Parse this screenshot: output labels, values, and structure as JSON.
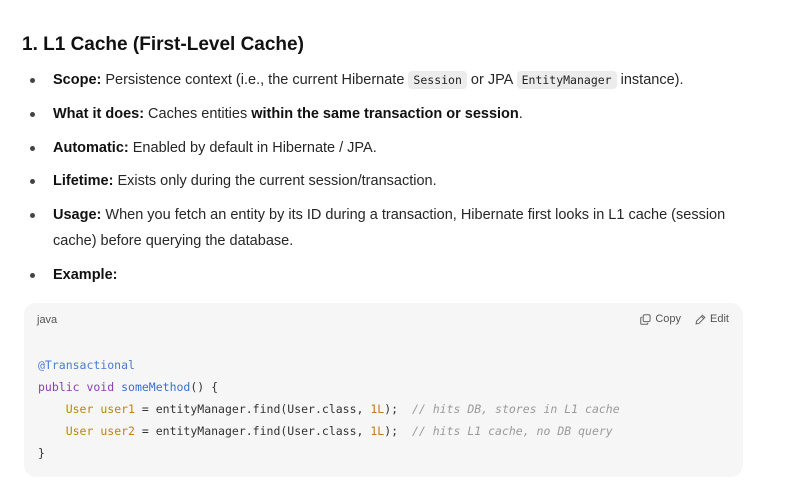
{
  "heading": "1. L1 Cache (First-Level Cache)",
  "bullets": [
    {
      "label": "Scope:",
      "text_a": " Persistence context (i.e., the current Hibernate ",
      "code_a": "Session",
      "text_b": " or JPA ",
      "code_b": "EntityManager",
      "text_c": " instance)."
    },
    {
      "label": "What it does:",
      "text_a": " Caches entities ",
      "bold": "within the same transaction or session",
      "text_b": "."
    },
    {
      "label": "Automatic:",
      "text_a": " Enabled by default in Hibernate / JPA."
    },
    {
      "label": "Lifetime:",
      "text_a": " Exists only during the current session/transaction."
    },
    {
      "label": "Usage:",
      "text_a": " When you fetch an entity by its ID during a transaction, Hibernate first looks in L1 cache (session",
      "text_b": "cache) before querying the database."
    },
    {
      "label": "Example:"
    }
  ],
  "code_block": {
    "language": "java",
    "copy_label": "Copy",
    "edit_label": "Edit",
    "lines": {
      "l1_annotation": "@Transactional",
      "l2_kw": "public void",
      "l2_fn": "someMethod",
      "l2_rest": "() {",
      "l3_type": "User",
      "l3_var": "user1",
      "l3_mid": " = entityManager.find(User.class, ",
      "l3_num": "1L",
      "l3_end": ");  ",
      "l3_comment": "// hits DB, stores in L1 cache",
      "l4_type": "User",
      "l4_var": "user2",
      "l4_mid": " = entityManager.find(User.class, ",
      "l4_num": "1L",
      "l4_end": ");  ",
      "l4_comment": "// hits L1 cache, no DB query",
      "l5": "}"
    }
  },
  "icons": {
    "copy": "copy-icon",
    "edit": "edit-icon"
  }
}
